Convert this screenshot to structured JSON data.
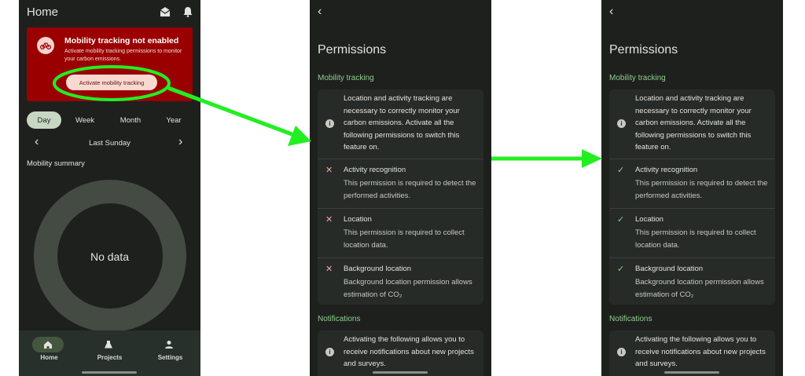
{
  "screen1": {
    "title": "Home",
    "icons": [
      "inbox-icon",
      "bell-icon"
    ],
    "banner": {
      "title": "Mobility tracking not enabled",
      "text": "Activate mobility tracking permissions to monitor your carbon emissions.",
      "button_label": "Activate mobility tracking",
      "icon": "bicycle-icon"
    },
    "periods": [
      "Day",
      "Week",
      "Month",
      "Year"
    ],
    "selected_period": "Day",
    "date_label": "Last Sunday",
    "summary_label": "Mobility summary",
    "chart_placeholder": "No data",
    "nav": [
      {
        "label": "Home",
        "icon": "home-icon"
      },
      {
        "label": "Projects",
        "icon": "flask-icon"
      },
      {
        "label": "Settings",
        "icon": "person-icon"
      }
    ]
  },
  "permissions_before": {
    "title": "Permissions",
    "section_mobility": "Mobility tracking",
    "intro": "Location and activity tracking are necessary to correctly monitor your carbon emissions. Activate all the following permissions to switch this feature on.",
    "items": [
      {
        "title": "Activity recognition",
        "text": "This permission is required to detect the performed activities.",
        "status": "denied"
      },
      {
        "title": "Location",
        "text": "This permission is required to collect location data.",
        "status": "denied"
      },
      {
        "title": "Background location",
        "text": "Background location permission allows estimation of CO₂",
        "status": "denied"
      }
    ],
    "section_notifications": "Notifications",
    "notifications_text": "Activating the following allows you to receive notifications about new projects and surveys."
  },
  "permissions_after": {
    "title": "Permissions",
    "section_mobility": "Mobility tracking",
    "intro": "Location and activity tracking are necessary to correctly monitor your carbon emissions. Activate all the following permissions to switch this feature on.",
    "items": [
      {
        "title": "Activity recognition",
        "text": "This permission is required to detect the performed activities.",
        "status": "granted"
      },
      {
        "title": "Location",
        "text": "This permission is required to collect location data.",
        "status": "granted"
      },
      {
        "title": "Background location",
        "text": "Background location permission allows estimation of CO₂",
        "status": "granted"
      }
    ],
    "section_notifications": "Notifications",
    "notifications_text": "Activating the following allows you to receive notifications about new projects and surveys."
  },
  "colors": {
    "background": "#1e201e",
    "banner": "#9b0000",
    "accent_green": "#8fcf8b",
    "annotation_green": "#22ee22",
    "denied": "#f0a79a"
  }
}
